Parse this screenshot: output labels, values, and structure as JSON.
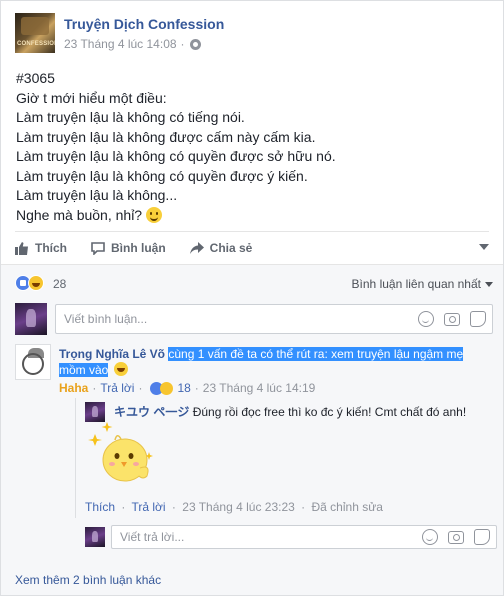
{
  "post": {
    "page_name": "Truyện Dịch Confession",
    "avatar_label": "CONFESSION",
    "timestamp": "23 Tháng 4 lúc 14:08",
    "dot": "·",
    "lines": [
      "#3065",
      "Giờ t mới hiểu một điều:",
      "Làm truyện lậu là không có tiếng nói.",
      "Làm truyện lậu là không được cấm này cấm kia.",
      "Làm truyện lậu là không có quyền được sở hữu nó.",
      "Làm truyện lậu là không có quyền được ý kiến.",
      "Làm truyện lậu là không..."
    ],
    "last_line": "Nghe mà buồn, nhỉ?"
  },
  "actions": {
    "like": "Thích",
    "comment": "Bình luận",
    "share": "Chia sẻ"
  },
  "summary": {
    "reaction_count": "28",
    "sort_label": "Bình luận liên quan nhất"
  },
  "composer": {
    "placeholder": "Viết bình luận..."
  },
  "comment": {
    "name": "Trọng Nghĩa Lê Võ",
    "text": "cùng 1 vấn đề ta có thể rút ra: xem truyện lậu ngậm mẹ mồm vào",
    "reaction_label": "Haha",
    "reply_label": "Trả lời",
    "reaction_count": "18",
    "timestamp": "23 Tháng 4 lúc 14:19",
    "sep": "·"
  },
  "reply": {
    "name": "キユウ ペ一ジ",
    "text": "Đúng rồi đọc free thì ko đc ý kiến! Cmt chất đó anh!",
    "like_label": "Thích",
    "reply_label": "Trả lời",
    "timestamp": "23 Tháng 4 lúc 23:23",
    "edited": "Đã chỉnh sửa",
    "sep": "·"
  },
  "reply_composer": {
    "placeholder": "Viết trả lời..."
  },
  "more_comments": "Xem thêm 2 bình luận khác",
  "colors": {
    "link_blue": "#365899",
    "haha_orange": "#e9a21c",
    "selection_blue": "#3390ff"
  }
}
